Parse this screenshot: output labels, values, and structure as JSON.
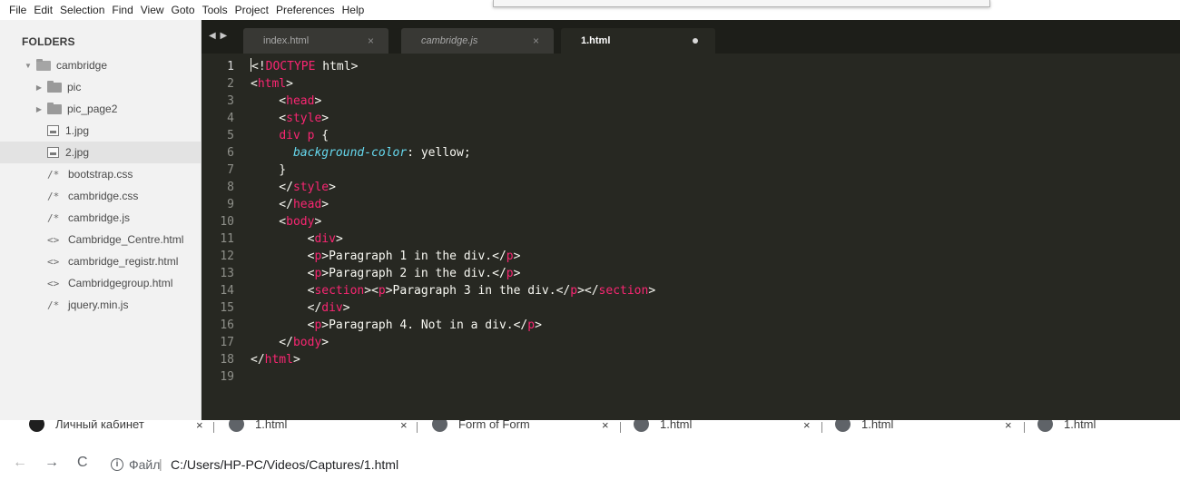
{
  "menu": [
    "File",
    "Edit",
    "Selection",
    "Find",
    "View",
    "Goto",
    "Tools",
    "Project",
    "Preferences",
    "Help"
  ],
  "sidebar": {
    "title": "FOLDERS",
    "root": "cambridge",
    "items": [
      {
        "label": "pic",
        "type": "folder"
      },
      {
        "label": "pic_page2",
        "type": "folder"
      },
      {
        "label": "1.jpg",
        "type": "image"
      },
      {
        "label": "2.jpg",
        "type": "image",
        "selected": true
      },
      {
        "label": "bootstrap.css",
        "type": "code",
        "glyph": "/*"
      },
      {
        "label": "cambridge.css",
        "type": "code",
        "glyph": "/*"
      },
      {
        "label": "cambridge.js",
        "type": "code",
        "glyph": "/*"
      },
      {
        "label": "Cambridge_Centre.html",
        "type": "markup",
        "glyph": "<>"
      },
      {
        "label": "cambridge_registr.html",
        "type": "markup",
        "glyph": "<>"
      },
      {
        "label": "Cambridgegroup.html",
        "type": "markup",
        "glyph": "<>"
      },
      {
        "label": "jquery.min.js",
        "type": "code",
        "glyph": "/*"
      }
    ]
  },
  "tabs": [
    {
      "label": "index.html",
      "close": "×",
      "active": false
    },
    {
      "label": "cambridge.js",
      "close": "×",
      "active": false
    },
    {
      "label": "1.html",
      "close": "●",
      "active": true
    }
  ],
  "tab_nav": "◀ ▶",
  "editor": {
    "line_numbers": [
      "1",
      "2",
      "3",
      "4",
      "5",
      "6",
      "7",
      "8",
      "9",
      "10",
      "11",
      "12",
      "13",
      "14",
      "15",
      "16",
      "17",
      "18",
      "19"
    ],
    "current_line": 1
  },
  "browser_tabs": [
    {
      "label": "Личный кабинет",
      "close": "×"
    },
    {
      "label": "1.html",
      "close": "×"
    },
    {
      "label": "Form of Form",
      "close": "×"
    },
    {
      "label": "1.html",
      "close": "×"
    },
    {
      "label": "1.html",
      "close": "×"
    },
    {
      "label": "1.html",
      "close": ""
    }
  ],
  "address": {
    "back": "←",
    "forward": "→",
    "reload": "C",
    "info": "i",
    "scheme": "Файл",
    "separator": "|",
    "url": "C:/Users/HP-PC/Videos/Captures/1.html"
  },
  "colors": {
    "editor_bg": "#272822",
    "tag": "#f92672",
    "property": "#66d9ef",
    "text": "#f8f8f2",
    "sidebar_bg": "#f2f2f2"
  }
}
